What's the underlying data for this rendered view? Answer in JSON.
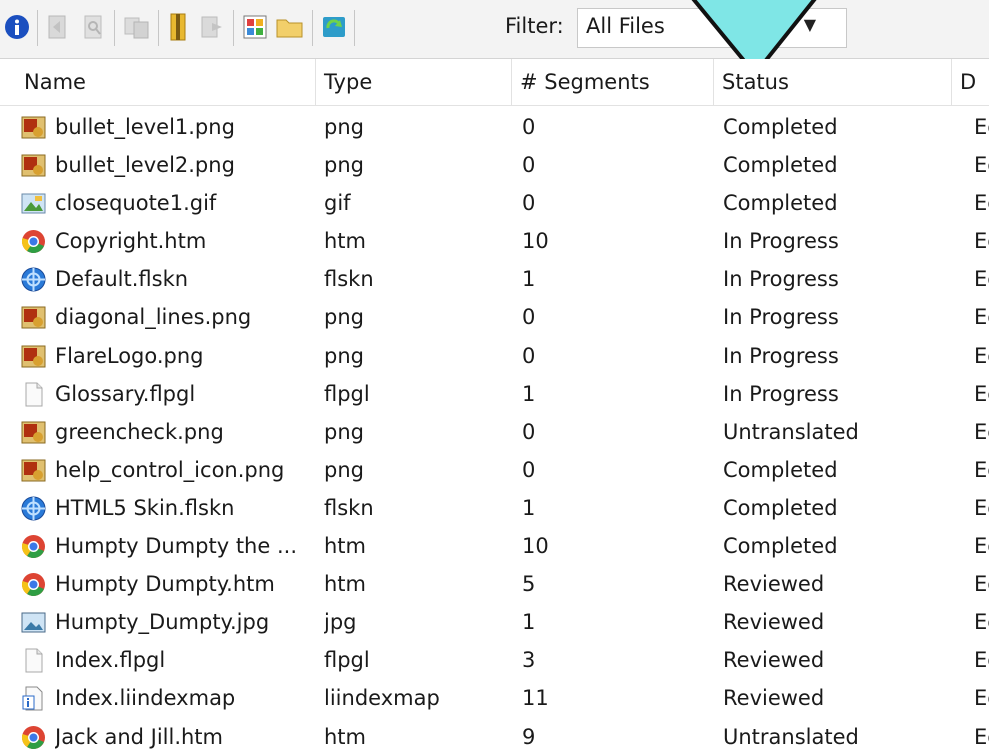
{
  "toolbar": {
    "buttons": [
      {
        "icon": "info-icon",
        "enabled": true
      },
      {
        "icon": "open-file-icon",
        "enabled": false
      },
      {
        "icon": "preview-icon",
        "enabled": false
      },
      {
        "icon": "copy-files-icon",
        "enabled": false
      },
      {
        "icon": "package-icon",
        "enabled": true
      },
      {
        "icon": "export-icon",
        "enabled": false
      },
      {
        "icon": "view-tiles-icon",
        "enabled": true
      },
      {
        "icon": "folder-icon",
        "enabled": true
      },
      {
        "icon": "refresh-icon",
        "enabled": true
      }
    ],
    "filter_label": "Filter:",
    "filter_value": "All Files"
  },
  "columns": [
    "Name",
    "Type",
    "# Segments",
    "Status",
    "D"
  ],
  "rows": [
    {
      "name": "bullet_level1.png",
      "type": "png",
      "segments": "0",
      "status": "Completed",
      "extra": "Ec",
      "icon": "png-image-icon"
    },
    {
      "name": "bullet_level2.png",
      "type": "png",
      "segments": "0",
      "status": "Completed",
      "extra": "Ec",
      "icon": "png-image-icon"
    },
    {
      "name": "closequote1.gif",
      "type": "gif",
      "segments": "0",
      "status": "Completed",
      "extra": "Ec",
      "icon": "gif-image-icon"
    },
    {
      "name": "Copyright.htm",
      "type": "htm",
      "segments": "10",
      "status": "In Progress",
      "extra": "Ec",
      "icon": "chrome-htm-icon"
    },
    {
      "name": "Default.flskn",
      "type": "flskn",
      "segments": "1",
      "status": "In Progress",
      "extra": "Ec",
      "icon": "skin-globe-icon"
    },
    {
      "name": "diagonal_lines.png",
      "type": "png",
      "segments": "0",
      "status": "In Progress",
      "extra": "Ec",
      "icon": "png-image-icon"
    },
    {
      "name": "FlareLogo.png",
      "type": "png",
      "segments": "0",
      "status": "In Progress",
      "extra": "Ec",
      "icon": "png-image-icon"
    },
    {
      "name": "Glossary.flpgl",
      "type": "flpgl",
      "segments": "1",
      "status": "In Progress",
      "extra": "Ec",
      "icon": "blank-file-icon"
    },
    {
      "name": "greencheck.png",
      "type": "png",
      "segments": "0",
      "status": "Untranslated",
      "extra": "Ec",
      "icon": "png-image-icon"
    },
    {
      "name": "help_control_icon.png",
      "type": "png",
      "segments": "0",
      "status": "Completed",
      "extra": "Ec",
      "icon": "png-image-icon"
    },
    {
      "name": "HTML5 Skin.flskn",
      "type": "flskn",
      "segments": "1",
      "status": "Completed",
      "extra": "Ec",
      "icon": "skin-globe-icon"
    },
    {
      "name": "Humpty Dumpty the ...",
      "type": "htm",
      "segments": "10",
      "status": "Completed",
      "extra": "Ec",
      "icon": "chrome-htm-icon"
    },
    {
      "name": "Humpty Dumpty.htm",
      "type": "htm",
      "segments": "5",
      "status": "Reviewed",
      "extra": "Ec",
      "icon": "chrome-htm-icon"
    },
    {
      "name": "Humpty_Dumpty.jpg",
      "type": "jpg",
      "segments": "1",
      "status": "Reviewed",
      "extra": "Ec",
      "icon": "jpg-image-icon"
    },
    {
      "name": "Index.flpgl",
      "type": "flpgl",
      "segments": "3",
      "status": "Reviewed",
      "extra": "Ec",
      "icon": "blank-file-icon"
    },
    {
      "name": "Index.liindexmap",
      "type": "liindexmap",
      "segments": "11",
      "status": "Reviewed",
      "extra": "Ec",
      "icon": "index-map-icon"
    },
    {
      "name": "Jack and Jill.htm",
      "type": "htm",
      "segments": "9",
      "status": "Untranslated",
      "extra": "Ec",
      "icon": "chrome-htm-icon"
    }
  ],
  "colors": {
    "callout": "#7fe6e6",
    "callout_border": "#111111"
  }
}
